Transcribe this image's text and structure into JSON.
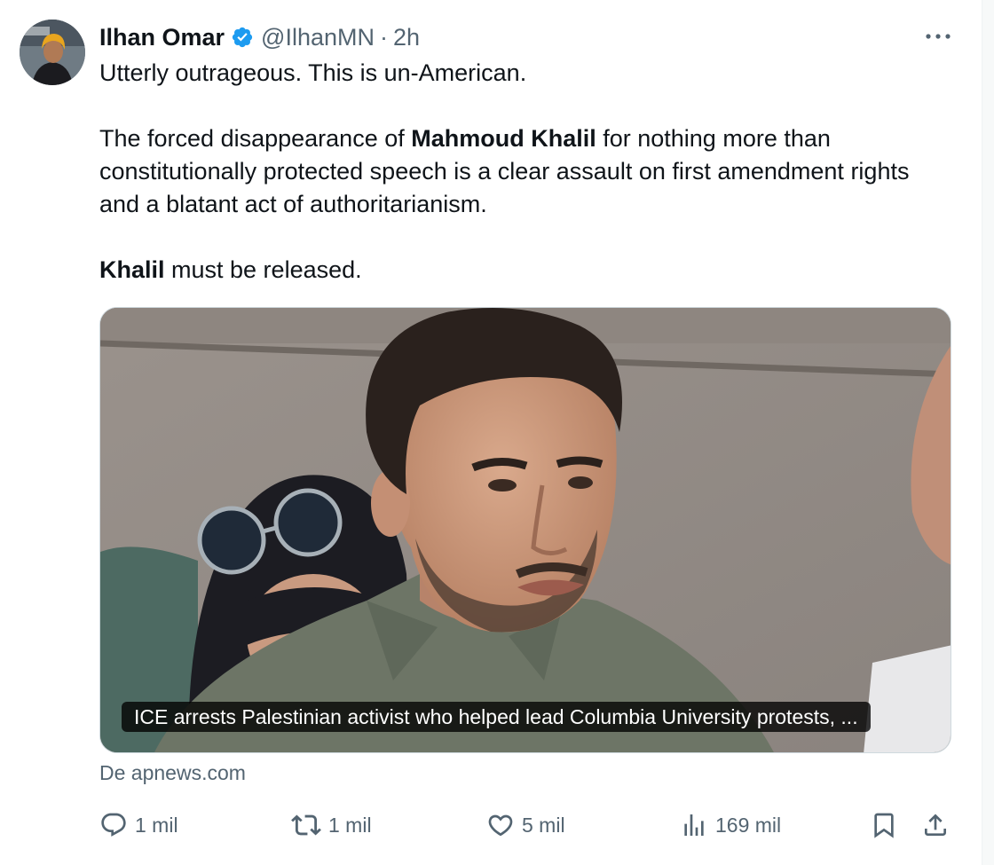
{
  "tweet": {
    "author_name": "Ilhan Omar",
    "handle": "@IlhanMN",
    "separator": "·",
    "time": "2h",
    "text": {
      "line1": "Utterly outrageous. This is un-American.",
      "para2_pre": "The forced disappearance of ",
      "para2_bold": "Mahmoud Khalil",
      "para2_post": " for nothing more than constitutionally protected speech is a clear assault on first amendment rights and a blatant act of authoritarianism.",
      "para3_bold": "Khalil",
      "para3_post": " must be released."
    },
    "media": {
      "caption": "ICE arrests Palestinian activist who helped lead Columbia University protests, ..."
    },
    "source": "De apnews.com",
    "actions": {
      "replies": "1 mil",
      "reposts": "1 mil",
      "likes": "5 mil",
      "views": "169 mil"
    },
    "colors": {
      "verified": "#1d9bf0",
      "muted": "#536471",
      "text": "#0f1419"
    },
    "icons": [
      "more-icon",
      "verified-badge-icon",
      "reply-icon",
      "repost-icon",
      "like-icon",
      "views-icon",
      "bookmark-icon",
      "share-icon"
    ]
  }
}
